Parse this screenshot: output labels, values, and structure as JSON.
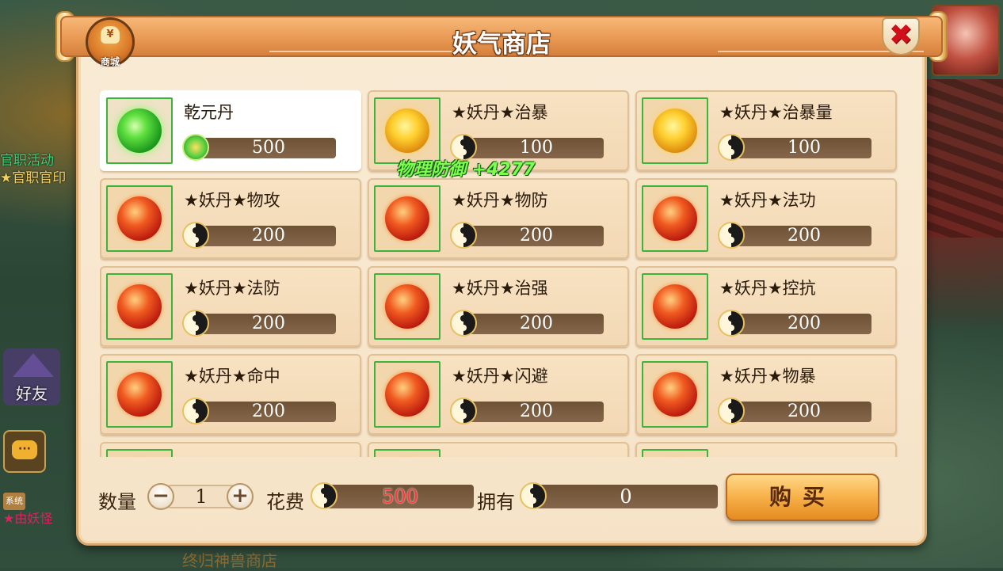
{
  "shop": {
    "title": "妖气商店",
    "badge_label": "商城",
    "badge_symbol": "¥",
    "close_symbol": "✖"
  },
  "background": {
    "side_line1": "官职活动",
    "side_line2": "★官职官印",
    "friend_label": "好友",
    "chat_symbol": "···",
    "system_badge": "系统",
    "system_text": "★由妖怪",
    "bottom_text": "终归神兽商店"
  },
  "float_text": "物理防御 +4277",
  "items": [
    {
      "name": "乾元丹",
      "price": "500",
      "icon": "green-elixir-orb",
      "currency": "gem",
      "selected": true
    },
    {
      "name": "★妖丹★治暴",
      "price": "100",
      "icon": "gold-demon-core",
      "currency": "yinyang"
    },
    {
      "name": "★妖丹★治暴量",
      "price": "100",
      "icon": "gold-demon-core",
      "currency": "yinyang"
    },
    {
      "name": "★妖丹★物攻",
      "price": "200",
      "icon": "red-demon-core",
      "currency": "yinyang"
    },
    {
      "name": "★妖丹★物防",
      "price": "200",
      "icon": "red-demon-core",
      "currency": "yinyang"
    },
    {
      "name": "★妖丹★法功",
      "price": "200",
      "icon": "red-demon-core",
      "currency": "yinyang"
    },
    {
      "name": "★妖丹★法防",
      "price": "200",
      "icon": "red-demon-core",
      "currency": "yinyang"
    },
    {
      "name": "★妖丹★治强",
      "price": "200",
      "icon": "red-demon-core",
      "currency": "yinyang"
    },
    {
      "name": "★妖丹★控抗",
      "price": "200",
      "icon": "red-demon-core",
      "currency": "yinyang"
    },
    {
      "name": "★妖丹★命中",
      "price": "200",
      "icon": "red-demon-core",
      "currency": "yinyang"
    },
    {
      "name": "★妖丹★闪避",
      "price": "200",
      "icon": "red-demon-core",
      "currency": "yinyang"
    },
    {
      "name": "★妖丹★物暴",
      "price": "200",
      "icon": "red-demon-core",
      "currency": "yinyang"
    },
    {
      "name": "",
      "price": "",
      "icon": "red-demon-core",
      "currency": "yinyang"
    },
    {
      "name": "",
      "price": "",
      "icon": "red-demon-core",
      "currency": "yinyang"
    },
    {
      "name": "",
      "price": "",
      "icon": "red-demon-core",
      "currency": "yinyang"
    }
  ],
  "purchase": {
    "quantity_label": "数量",
    "quantity": "1",
    "minus_symbol": "−",
    "plus_symbol": "+",
    "cost_label": "花费",
    "cost": "500",
    "owned_label": "拥有",
    "owned": "0",
    "buy_label": "购买"
  }
}
